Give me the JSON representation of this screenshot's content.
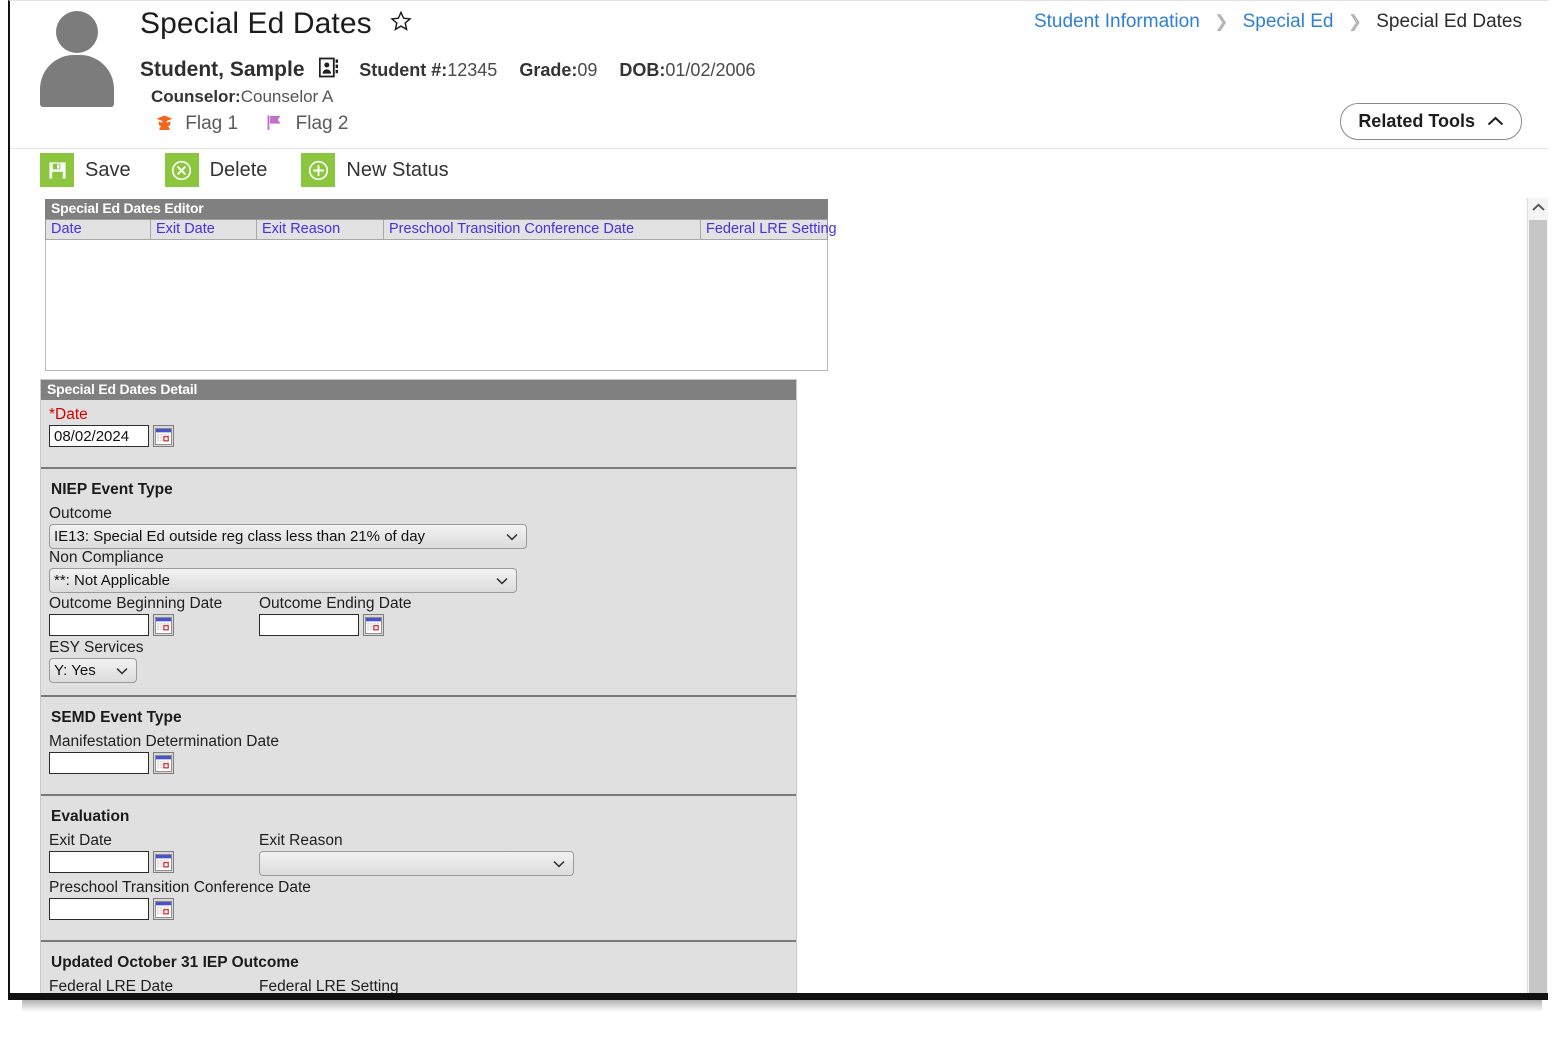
{
  "header": {
    "title": "Special Ed Dates",
    "favorite_icon": "star-icon",
    "student_name": "Student, Sample",
    "contact_icon": "contact-card-icon",
    "student_number_label": "Student #:",
    "student_number": "12345",
    "grade_label": "Grade:",
    "grade": "09",
    "dob_label": "DOB:",
    "dob": "01/02/2006",
    "counselor_label": "Counselor:",
    "counselor": "Counselor A",
    "flags": [
      {
        "label": "Flag 1",
        "icon": "graduate-flag-icon",
        "color": "#f4651f"
      },
      {
        "label": "Flag 2",
        "icon": "flag-icon",
        "color": "#c071c6"
      }
    ],
    "breadcrumb": [
      {
        "label": "Student Information",
        "link": true
      },
      {
        "label": "Special Ed",
        "link": true
      },
      {
        "label": "Special Ed Dates",
        "link": false
      }
    ],
    "related_tools_label": "Related Tools",
    "related_tools_icon": "chevron-up-icon"
  },
  "toolbar": {
    "buttons": [
      {
        "label": "Save",
        "icon": "save-disk-icon"
      },
      {
        "label": "Delete",
        "icon": "delete-x-icon"
      },
      {
        "label": "New Status",
        "icon": "plus-icon"
      }
    ],
    "accent_color": "#8cc63e"
  },
  "editor": {
    "title": "Special Ed Dates Editor",
    "columns": [
      "Date",
      "Exit Date",
      "Exit Reason",
      "Preschool Transition Conference Date",
      "Federal LRE Setting"
    ],
    "rows": []
  },
  "detail": {
    "title": "Special Ed Dates Detail",
    "date": {
      "label": "*Date",
      "value": "08/02/2024",
      "calendar_icon": "calendar-icon"
    },
    "niep": {
      "title": "NIEP Event Type",
      "outcome_label": "Outcome",
      "outcome_value": "IE13: Special Ed outside reg class less than 21% of day",
      "non_compliance_label": "Non Compliance",
      "non_compliance_value": "**: Not Applicable",
      "outcome_begin_label": "Outcome Beginning Date",
      "outcome_begin_value": "",
      "outcome_end_label": "Outcome Ending Date",
      "outcome_end_value": "",
      "esy_label": "ESY Services",
      "esy_value": "Y: Yes"
    },
    "semd": {
      "title": "SEMD Event Type",
      "manifestation_label": "Manifestation Determination Date",
      "manifestation_value": ""
    },
    "evaluation": {
      "title": "Evaluation",
      "exit_date_label": "Exit Date",
      "exit_date_value": "",
      "exit_reason_label": "Exit Reason",
      "exit_reason_value": "",
      "preschool_label": "Preschool Transition Conference Date",
      "preschool_value": ""
    },
    "oct31": {
      "title": "Updated October 31 IEP Outcome",
      "federal_lre_date_label": "Federal LRE Date",
      "federal_lre_date_value": "",
      "federal_lre_setting_label": "Federal LRE Setting",
      "federal_lre_setting_value": ""
    }
  },
  "scrollbar": {
    "up_arrow_icon": "chevron-up-icon"
  }
}
